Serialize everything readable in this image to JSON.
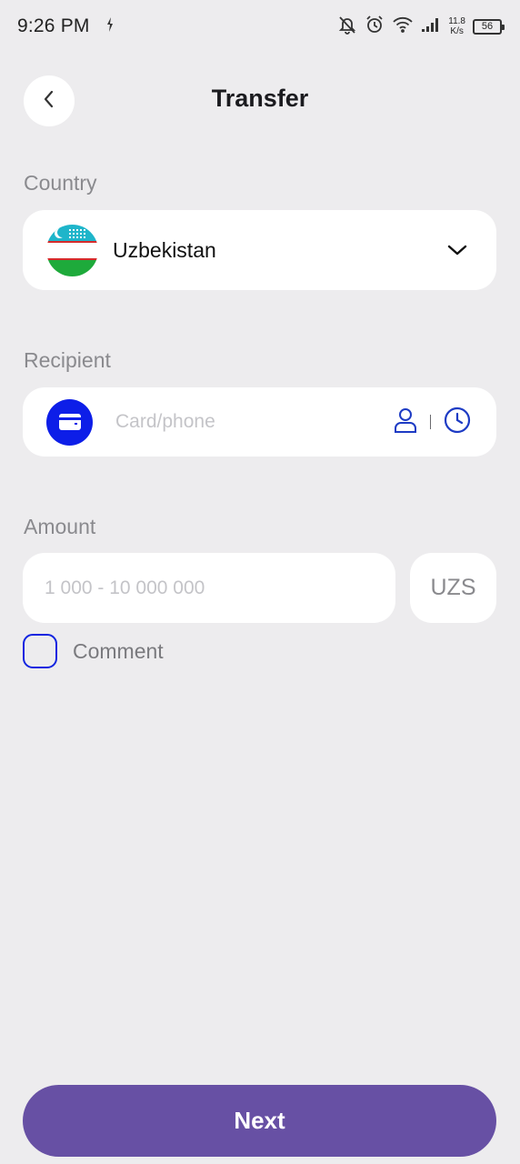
{
  "status_bar": {
    "time": "9:26 PM",
    "speed_value": "11.8",
    "speed_unit": "K/s",
    "battery": "56",
    "icons": [
      "sync-icon",
      "bell-off-icon",
      "alarm-icon",
      "wifi-icon",
      "signal-icon",
      "battery-icon"
    ]
  },
  "header": {
    "title": "Transfer",
    "back_icon": "chevron-left-icon"
  },
  "country": {
    "label": "Country",
    "selected": "Uzbekistan",
    "flag": "uzbekistan-flag-icon"
  },
  "recipient": {
    "label": "Recipient",
    "placeholder": "Card/phone",
    "value": "",
    "icons": [
      "wallet-card-icon",
      "contacts-icon",
      "history-clock-icon"
    ]
  },
  "amount": {
    "label": "Amount",
    "placeholder": "1 000 - 10 000 000",
    "value": "",
    "currency": "UZS"
  },
  "comment": {
    "label": "Comment",
    "checked": false
  },
  "actions": {
    "next_label": "Next"
  },
  "colors": {
    "background": "#edecee",
    "accent_button": "#6750a4",
    "card_icon_bg": "#0d1ee8",
    "checkbox_border": "#1225e0",
    "icon_blue": "#1d3bc4"
  }
}
